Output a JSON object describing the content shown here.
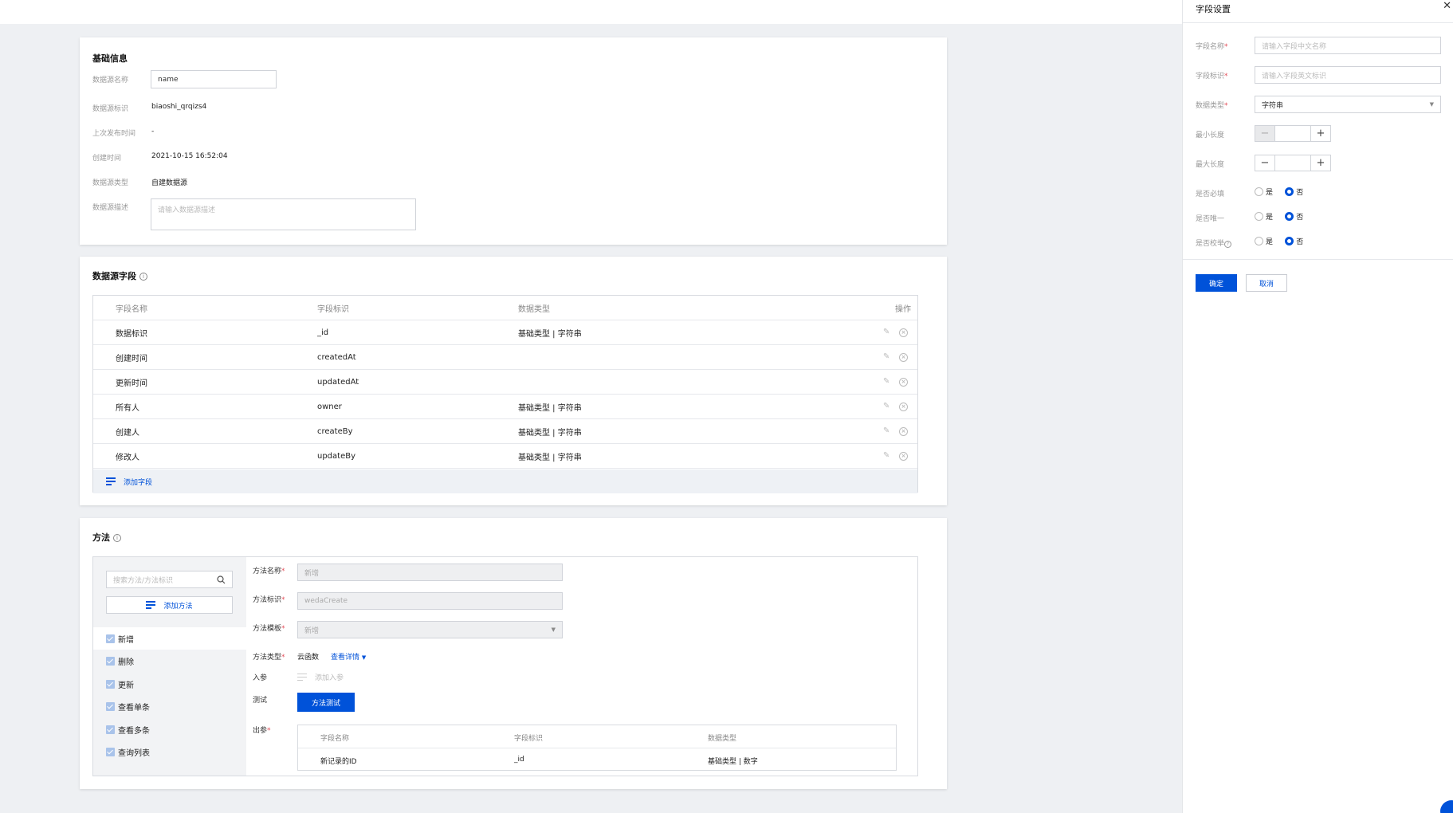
{
  "basic": {
    "title": "基础信息",
    "rows": [
      {
        "label": "数据源名称",
        "value": "name"
      },
      {
        "label": "数据源标识",
        "value": "biaoshi_qrqizs4"
      },
      {
        "label": "上次发布时间",
        "value": "-"
      },
      {
        "label": "创建时间",
        "value": "2021-10-15 16:52:04"
      },
      {
        "label": "数据源类型",
        "value": "自建数据源"
      },
      {
        "label": "数据源描述",
        "placeholder": "请输入数据源描述"
      }
    ]
  },
  "fields": {
    "title": "数据源字段",
    "columns": [
      "字段名称",
      "字段标识",
      "数据类型",
      "操作"
    ],
    "rows": [
      {
        "name": "数据标识",
        "id": "_id",
        "type": "基础类型 | 字符串"
      },
      {
        "name": "创建时间",
        "id": "createdAt",
        "type": ""
      },
      {
        "name": "更新时间",
        "id": "updatedAt",
        "type": ""
      },
      {
        "name": "所有人",
        "id": "owner",
        "type": "基础类型 | 字符串"
      },
      {
        "name": "创建人",
        "id": "createBy",
        "type": "基础类型 | 字符串"
      },
      {
        "name": "修改人",
        "id": "updateBy",
        "type": "基础类型 | 字符串"
      }
    ],
    "add_label": "添加字段"
  },
  "methods": {
    "title": "方法",
    "search_placeholder": "搜索方法/方法标识",
    "add_label": "添加方法",
    "list": [
      "新增",
      "删除",
      "更新",
      "查看单条",
      "查看多条",
      "查询列表"
    ],
    "form": {
      "name_label": "方法名称",
      "name_value": "新增",
      "id_label": "方法标识",
      "id_value": "wedaCreate",
      "template_label": "方法模板",
      "template_value": "新增",
      "type_label": "方法类型",
      "type_value": "云函数",
      "type_link": "查看详情",
      "params_label": "入参",
      "params_add": "添加入参",
      "test_label": "测试",
      "test_button": "方法测试",
      "output_label": "出参",
      "output_columns": [
        "字段名称",
        "字段标识",
        "数据类型"
      ],
      "output_rows": [
        {
          "name": "新记录的ID",
          "id": "_id",
          "type": "基础类型 | 数字"
        }
      ]
    }
  },
  "panel": {
    "title": "字段设置",
    "name_label": "字段名称",
    "name_placeholder": "请输入字段中文名称",
    "id_label": "字段标识",
    "id_placeholder": "请输入字段英文标识",
    "type_label": "数据类型",
    "type_value": "字符串",
    "min_label": "最小长度",
    "max_label": "最大长度",
    "required_label": "是否必填",
    "unique_label": "是否唯一",
    "check_label": "是否校举",
    "yes": "是",
    "no": "否",
    "confirm": "确定",
    "cancel": "取消"
  }
}
